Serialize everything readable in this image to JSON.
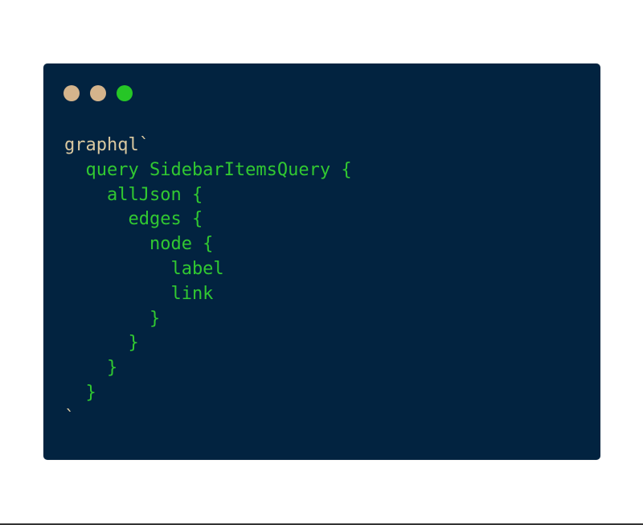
{
  "colors": {
    "background": "#ffffff",
    "window_background": "#022340",
    "dot_1": "#d4b48c",
    "dot_2": "#d4b48c",
    "dot_3": "#26c626",
    "tag_text": "#d9c8a0",
    "code_text": "#31c831",
    "bottom_rule": "#333333"
  },
  "window": {
    "dots": [
      {
        "icon": "window-dot-icon",
        "color": "#d4b48c"
      },
      {
        "icon": "window-dot-icon",
        "color": "#d4b48c"
      },
      {
        "icon": "window-dot-icon",
        "color": "#26c626"
      }
    ]
  },
  "code": {
    "lines": [
      {
        "text": "graphql`",
        "style": "tag"
      },
      {
        "text": "  query SidebarItemsQuery {",
        "style": "code"
      },
      {
        "text": "    allJson {",
        "style": "code"
      },
      {
        "text": "      edges {",
        "style": "code"
      },
      {
        "text": "        node {",
        "style": "code"
      },
      {
        "text": "          label",
        "style": "code"
      },
      {
        "text": "          link",
        "style": "code"
      },
      {
        "text": "        }",
        "style": "code"
      },
      {
        "text": "      }",
        "style": "code"
      },
      {
        "text": "    }",
        "style": "code"
      },
      {
        "text": "  }",
        "style": "code"
      },
      {
        "text": "`",
        "style": "tag"
      }
    ]
  }
}
